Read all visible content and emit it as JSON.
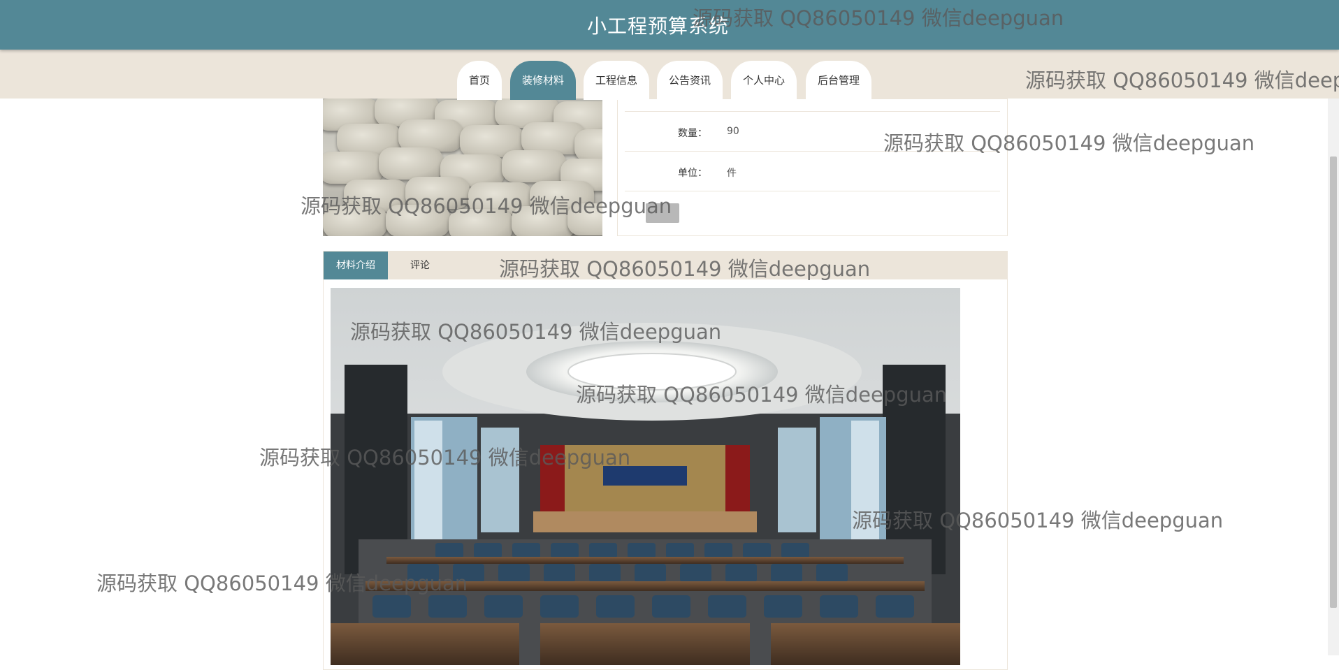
{
  "header": {
    "title": "小工程预算系统"
  },
  "nav": {
    "items": [
      {
        "label": "首页",
        "active": false
      },
      {
        "label": "装修材料",
        "active": true
      },
      {
        "label": "工程信息",
        "active": false
      },
      {
        "label": "公告资讯",
        "active": false
      },
      {
        "label": "个人中心",
        "active": false
      },
      {
        "label": "后台管理",
        "active": false
      }
    ]
  },
  "details": {
    "quantity_label": "数量：",
    "quantity_value": "90",
    "unit_label": "单位：",
    "unit_value": "件"
  },
  "tabs": [
    {
      "label": "材料介绍",
      "active": true
    },
    {
      "label": "评论",
      "active": false
    }
  ],
  "watermark": "源码获取 QQ86050149 微信deepguan",
  "colors": {
    "primary": "#538896",
    "nav_bg": "#ece5da",
    "border": "#ece5da"
  }
}
